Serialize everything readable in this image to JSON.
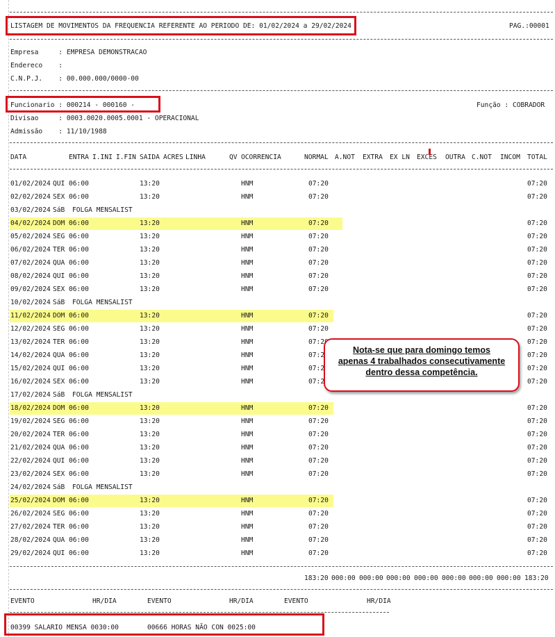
{
  "header": {
    "title": "LISTAGEM DE MOVIMENTOS DA FREQUENCIA REFERENTE AO PERIODO DE: 01/02/2024 a 29/02/2024",
    "page": "PAG.:00001"
  },
  "company": {
    "empresa": "Empresa     : EMPRESA DEMONSTRACAO",
    "endereco": "Endereco    :",
    "cnpj": "C.N.P.J.    : 00.000.000/0000-00"
  },
  "employee": {
    "funcionario": "Funcionario : 000214 - 000160 -",
    "funcao": "Função : COBRADOR",
    "divisao": "Divisao     : 0003.0020.0005.0001 - OPERACIONAL",
    "admissao": "Admissão    : 11/10/1988"
  },
  "columns": [
    "DATA",
    "ENTRA",
    "I.INI",
    "I.FIN",
    "SAIDA",
    "ACRES",
    "LINHA",
    "QV",
    "OCORRENCIA",
    "NORMAL",
    "A.NOT",
    "EXTRA",
    "EX LN",
    "EXCES",
    "OUTRA",
    "C.NOT",
    "INCOM",
    "TOTAL"
  ],
  "rows": [
    {
      "date": "01/02/2024",
      "day": "QUI",
      "in": "06:00",
      "out": "13:20",
      "occ": "HNM",
      "normal": "07:20",
      "total": "07:20",
      "hl": false
    },
    {
      "date": "02/02/2024",
      "day": "SEX",
      "in": "06:00",
      "out": "13:20",
      "occ": "HNM",
      "normal": "07:20",
      "total": "07:20",
      "hl": false
    },
    {
      "date": "03/02/2024",
      "day": "SáB",
      "folga": "FOLGA MENSALIST"
    },
    {
      "date": "04/02/2024",
      "day": "DOM",
      "in": "06:00",
      "out": "13:20",
      "occ": "HNM",
      "normal": "07:20",
      "total": "07:20",
      "hl": true
    },
    {
      "date": "05/02/2024",
      "day": "SEG",
      "in": "06:00",
      "out": "13:20",
      "occ": "HNM",
      "normal": "07:20",
      "total": "07:20",
      "hl": false
    },
    {
      "date": "06/02/2024",
      "day": "TER",
      "in": "06:00",
      "out": "13:20",
      "occ": "HNM",
      "normal": "07:20",
      "total": "07:20",
      "hl": false
    },
    {
      "date": "07/02/2024",
      "day": "QUA",
      "in": "06:00",
      "out": "13:20",
      "occ": "HNM",
      "normal": "07:20",
      "total": "07:20",
      "hl": false
    },
    {
      "date": "08/02/2024",
      "day": "QUI",
      "in": "06:00",
      "out": "13:20",
      "occ": "HNM",
      "normal": "07:20",
      "total": "07:20",
      "hl": false
    },
    {
      "date": "09/02/2024",
      "day": "SEX",
      "in": "06:00",
      "out": "13:20",
      "occ": "HNM",
      "normal": "07:20",
      "total": "07:20",
      "hl": false
    },
    {
      "date": "10/02/2024",
      "day": "SáB",
      "folga": "FOLGA MENSALIST"
    },
    {
      "date": "11/02/2024",
      "day": "DOM",
      "in": "06:00",
      "out": "13:20",
      "occ": "HNM",
      "normal": "07:20",
      "total": "07:20",
      "hl": true
    },
    {
      "date": "12/02/2024",
      "day": "SEG",
      "in": "06:00",
      "out": "13:20",
      "occ": "HNM",
      "normal": "07:20",
      "total": "07:20",
      "hl": false
    },
    {
      "date": "13/02/2024",
      "day": "TER",
      "in": "06:00",
      "out": "13:20",
      "occ": "HNM",
      "normal": "07:20",
      "total": "07:20",
      "hl": false
    },
    {
      "date": "14/02/2024",
      "day": "QUA",
      "in": "06:00",
      "out": "13:20",
      "occ": "HNM",
      "normal": "07:20",
      "total": "07:20",
      "hl": false
    },
    {
      "date": "15/02/2024",
      "day": "QUI",
      "in": "06:00",
      "out": "13:20",
      "occ": "HNM",
      "normal": "07:20",
      "total": "07:20",
      "hl": false
    },
    {
      "date": "16/02/2024",
      "day": "SEX",
      "in": "06:00",
      "out": "13:20",
      "occ": "HNM",
      "normal": "07:20",
      "total": "07:20",
      "hl": false
    },
    {
      "date": "17/02/2024",
      "day": "SáB",
      "folga": "FOLGA MENSALIST"
    },
    {
      "date": "18/02/2024",
      "day": "DOM",
      "in": "06:00",
      "out": "13:20",
      "occ": "HNM",
      "normal": "07:20",
      "total": "07:20",
      "hl": true
    },
    {
      "date": "19/02/2024",
      "day": "SEG",
      "in": "06:00",
      "out": "13:20",
      "occ": "HNM",
      "normal": "07:20",
      "total": "07:20",
      "hl": false
    },
    {
      "date": "20/02/2024",
      "day": "TER",
      "in": "06:00",
      "out": "13:20",
      "occ": "HNM",
      "normal": "07:20",
      "total": "07:20",
      "hl": false
    },
    {
      "date": "21/02/2024",
      "day": "QUA",
      "in": "06:00",
      "out": "13:20",
      "occ": "HNM",
      "normal": "07:20",
      "total": "07:20",
      "hl": false
    },
    {
      "date": "22/02/2024",
      "day": "QUI",
      "in": "06:00",
      "out": "13:20",
      "occ": "HNM",
      "normal": "07:20",
      "total": "07:20",
      "hl": false
    },
    {
      "date": "23/02/2024",
      "day": "SEX",
      "in": "06:00",
      "out": "13:20",
      "occ": "HNM",
      "normal": "07:20",
      "total": "07:20",
      "hl": false
    },
    {
      "date": "24/02/2024",
      "day": "SáB",
      "folga": "FOLGA MENSALIST"
    },
    {
      "date": "25/02/2024",
      "day": "DOM",
      "in": "06:00",
      "out": "13:20",
      "occ": "HNM",
      "normal": "07:20",
      "total": "07:20",
      "hl": true
    },
    {
      "date": "26/02/2024",
      "day": "SEG",
      "in": "06:00",
      "out": "13:20",
      "occ": "HNM",
      "normal": "07:20",
      "total": "07:20",
      "hl": false
    },
    {
      "date": "27/02/2024",
      "day": "TER",
      "in": "06:00",
      "out": "13:20",
      "occ": "HNM",
      "normal": "07:20",
      "total": "07:20",
      "hl": false
    },
    {
      "date": "28/02/2024",
      "day": "QUA",
      "in": "06:00",
      "out": "13:20",
      "occ": "HNM",
      "normal": "07:20",
      "total": "07:20",
      "hl": false
    },
    {
      "date": "29/02/2024",
      "day": "QUI",
      "in": "06:00",
      "out": "13:20",
      "occ": "HNM",
      "normal": "07:20",
      "total": "07:20",
      "hl": false
    }
  ],
  "totals": [
    "183:20",
    "000:00",
    "000:00",
    "000:00",
    "000:00",
    "000:00",
    "000:00",
    "000:00",
    "183:20"
  ],
  "events_header": [
    "EVENTO",
    "HR/DIA",
    "EVENTO",
    "HR/DIA",
    "EVENTO",
    "HR/DIA"
  ],
  "events": [
    {
      "text": "00399 SALARIO MENSA 0030:00"
    },
    {
      "text": "00666 HORAS NÃO CON 0025:00"
    }
  ],
  "callout": {
    "line1": "Nota-se que para domingo temos",
    "line2": "apenas 4 trabalhados consecutivamente",
    "line3": "dentro dessa competência."
  },
  "colors": {
    "highlight": "#fbfb8c",
    "annotation_red": "#d90f1a"
  }
}
